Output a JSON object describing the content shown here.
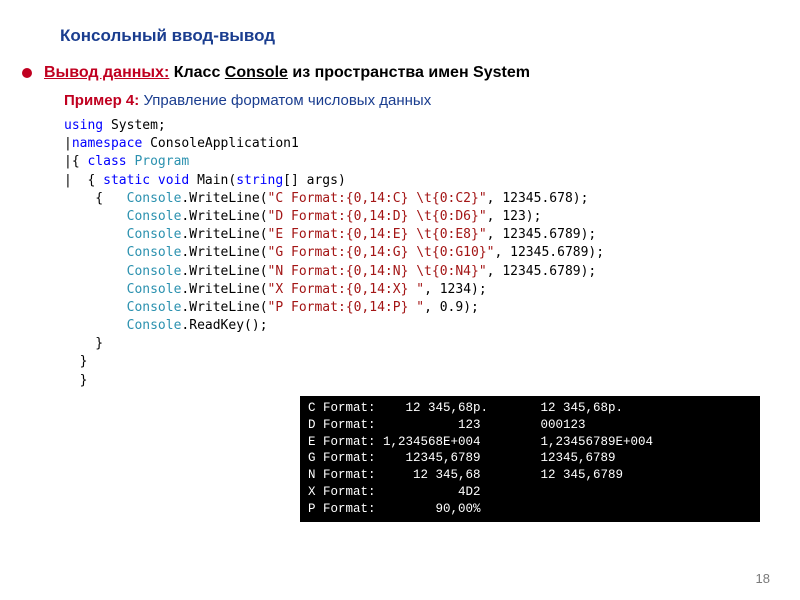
{
  "title": "Консольный ввод-вывод",
  "sub": {
    "red": "Вывод данных:",
    "rest_prefix": "   Класс ",
    "console_word": "Console",
    "rest_suffix": " из пространства имен System"
  },
  "example": {
    "label": "Пример 4: ",
    "desc": "Управление форматом числовых данных"
  },
  "code_lines": [
    {
      "parts": [
        {
          "t": "using ",
          "c": "kw"
        },
        {
          "t": "System;",
          "c": "plain"
        }
      ]
    },
    {
      "parts": [
        {
          "t": "|",
          "c": "plain"
        },
        {
          "t": "namespace ",
          "c": "kw"
        },
        {
          "t": "ConsoleApplication1",
          "c": "plain"
        }
      ]
    },
    {
      "parts": [
        {
          "t": "|{ ",
          "c": "plain"
        },
        {
          "t": "class ",
          "c": "kw"
        },
        {
          "t": "Program",
          "c": "type"
        }
      ]
    },
    {
      "parts": [
        {
          "t": "|  { ",
          "c": "plain"
        },
        {
          "t": "static void ",
          "c": "kw"
        },
        {
          "t": "Main(",
          "c": "plain"
        },
        {
          "t": "string",
          "c": "kw"
        },
        {
          "t": "[] args)",
          "c": "plain"
        }
      ]
    },
    {
      "parts": [
        {
          "t": "    {   ",
          "c": "plain"
        },
        {
          "t": "Console",
          "c": "type"
        },
        {
          "t": ".WriteLine(",
          "c": "plain"
        },
        {
          "t": "\"C Format:{0,14:C} \\t{0:C2}\"",
          "c": "str"
        },
        {
          "t": ", 12345.678);",
          "c": "plain"
        }
      ]
    },
    {
      "parts": [
        {
          "t": "        ",
          "c": "plain"
        },
        {
          "t": "Console",
          "c": "type"
        },
        {
          "t": ".WriteLine(",
          "c": "plain"
        },
        {
          "t": "\"D Format:{0,14:D} \\t{0:D6}\"",
          "c": "str"
        },
        {
          "t": ", 123);",
          "c": "plain"
        }
      ]
    },
    {
      "parts": [
        {
          "t": "        ",
          "c": "plain"
        },
        {
          "t": "Console",
          "c": "type"
        },
        {
          "t": ".WriteLine(",
          "c": "plain"
        },
        {
          "t": "\"E Format:{0,14:E} \\t{0:E8}\"",
          "c": "str"
        },
        {
          "t": ", 12345.6789);",
          "c": "plain"
        }
      ]
    },
    {
      "parts": [
        {
          "t": "        ",
          "c": "plain"
        },
        {
          "t": "Console",
          "c": "type"
        },
        {
          "t": ".WriteLine(",
          "c": "plain"
        },
        {
          "t": "\"G Format:{0,14:G} \\t{0:G10}\"",
          "c": "str"
        },
        {
          "t": ", 12345.6789);",
          "c": "plain"
        }
      ]
    },
    {
      "parts": [
        {
          "t": "        ",
          "c": "plain"
        },
        {
          "t": "Console",
          "c": "type"
        },
        {
          "t": ".WriteLine(",
          "c": "plain"
        },
        {
          "t": "\"N Format:{0,14:N} \\t{0:N4}\"",
          "c": "str"
        },
        {
          "t": ", 12345.6789);",
          "c": "plain"
        }
      ]
    },
    {
      "parts": [
        {
          "t": "        ",
          "c": "plain"
        },
        {
          "t": "Console",
          "c": "type"
        },
        {
          "t": ".WriteLine(",
          "c": "plain"
        },
        {
          "t": "\"X Format:{0,14:X} \"",
          "c": "str"
        },
        {
          "t": ", 1234);",
          "c": "plain"
        }
      ]
    },
    {
      "parts": [
        {
          "t": "        ",
          "c": "plain"
        },
        {
          "t": "Console",
          "c": "type"
        },
        {
          "t": ".WriteLine(",
          "c": "plain"
        },
        {
          "t": "\"P Format:{0,14:P} \"",
          "c": "str"
        },
        {
          "t": ", 0.9);",
          "c": "plain"
        }
      ]
    },
    {
      "parts": [
        {
          "t": "        ",
          "c": "plain"
        },
        {
          "t": "Console",
          "c": "type"
        },
        {
          "t": ".ReadKey();",
          "c": "plain"
        }
      ]
    },
    {
      "parts": [
        {
          "t": "    }",
          "c": "plain"
        }
      ]
    },
    {
      "parts": [
        {
          "t": "  }",
          "c": "plain"
        }
      ]
    },
    {
      "parts": [
        {
          "t": "  }",
          "c": "plain"
        }
      ]
    }
  ],
  "console_output": [
    "C Format:    12 345,68p.       12 345,68p.",
    "D Format:           123        000123",
    "E Format: 1,234568E+004        1,23456789E+004",
    "G Format:    12345,6789        12345,6789",
    "N Format:     12 345,68        12 345,6789",
    "X Format:           4D2",
    "P Format:        90,00%"
  ],
  "pagenum": "18"
}
